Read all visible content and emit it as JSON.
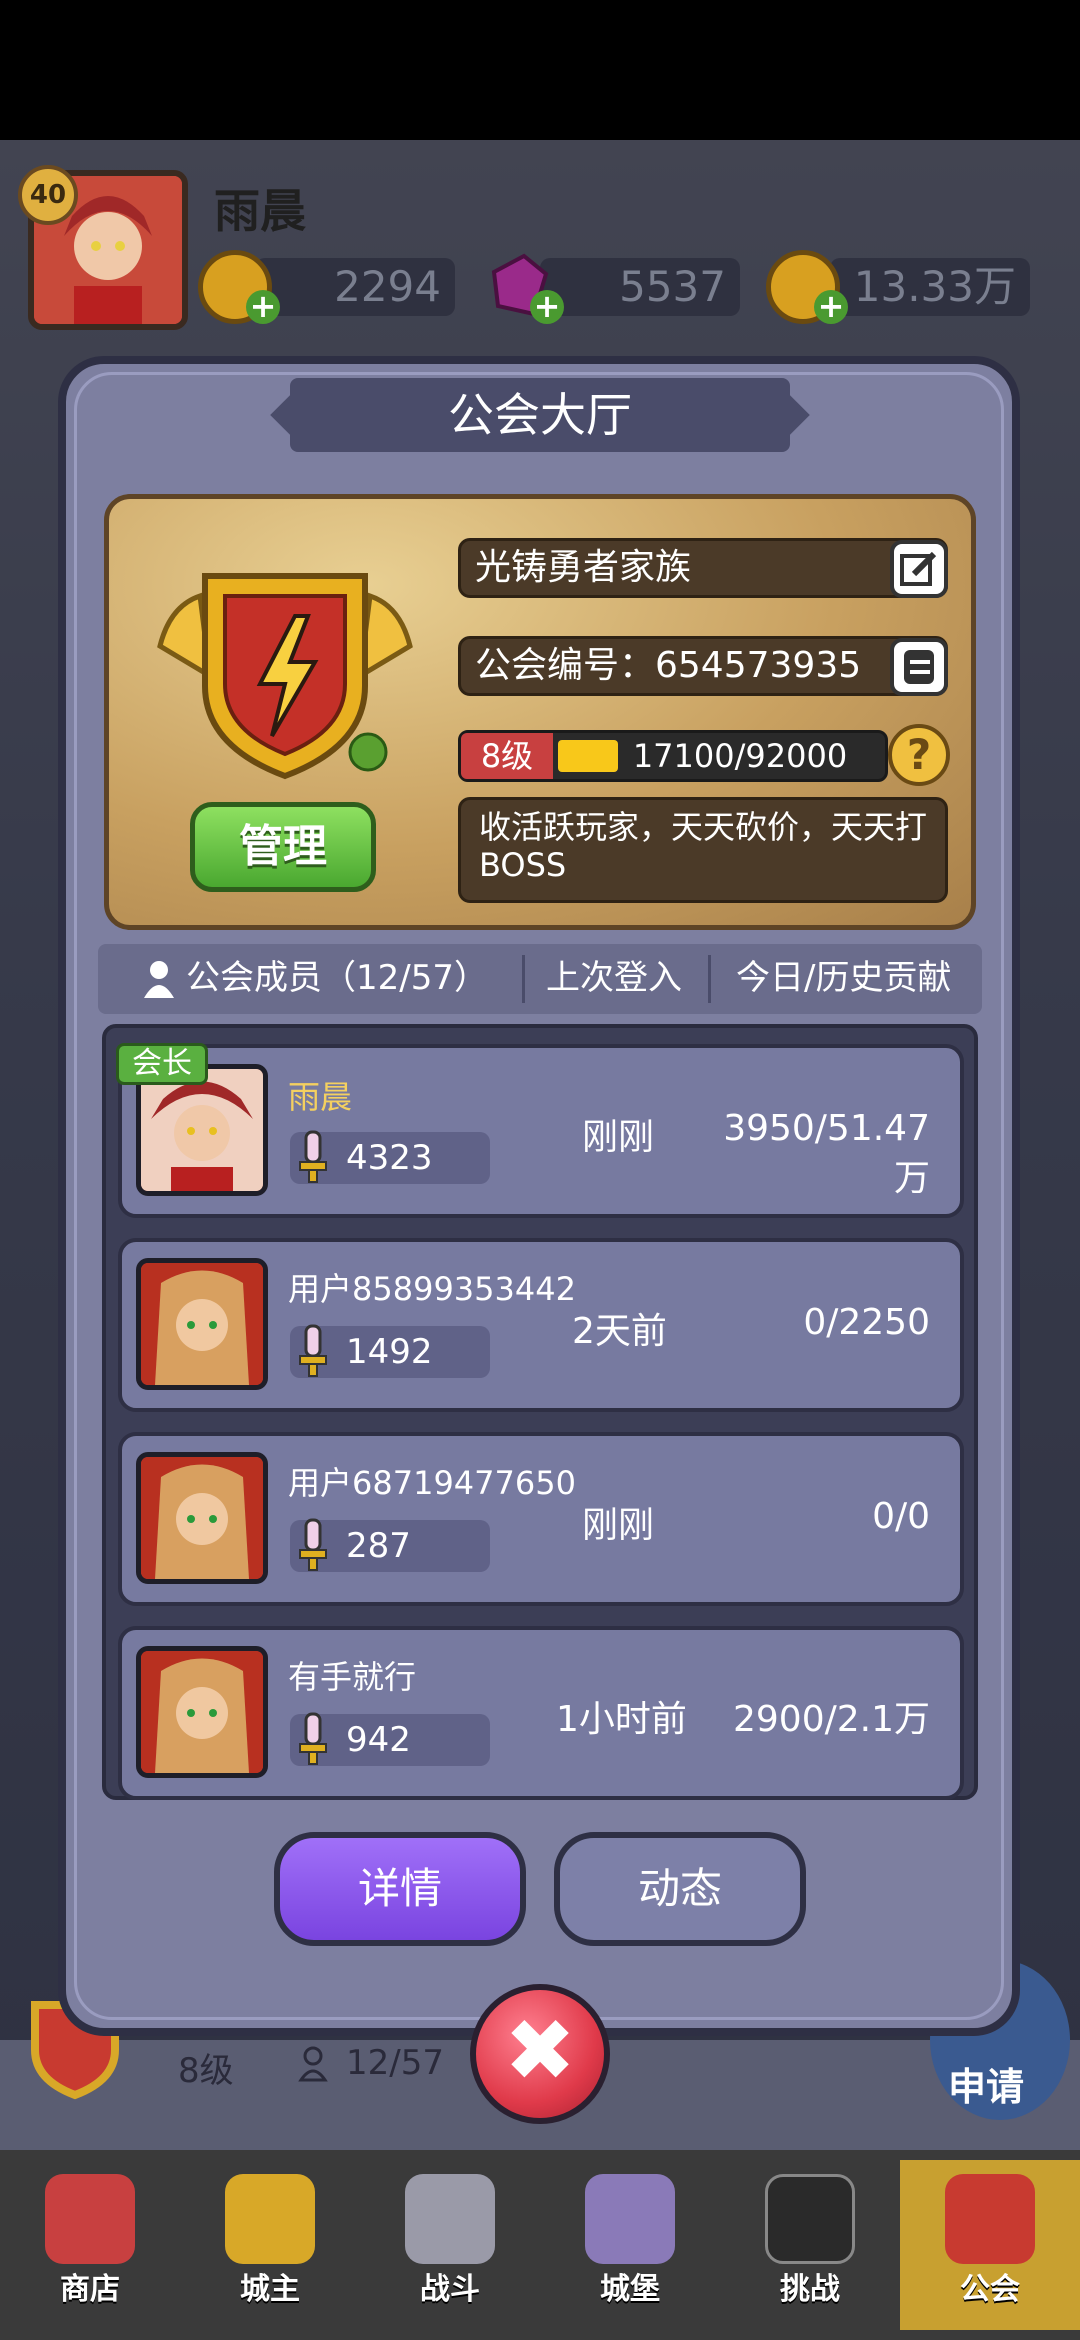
{
  "player": {
    "level": "40",
    "name": "雨晨"
  },
  "resources": [
    {
      "icon": "gold-coin-icon",
      "value": "2294"
    },
    {
      "icon": "purple-gem-icon",
      "value": "5537"
    },
    {
      "icon": "star-coin-icon",
      "value": "13.33万"
    }
  ],
  "panel": {
    "title": "公会大厅"
  },
  "guild": {
    "name": "光铸勇者家族",
    "id_label": "公会编号：654573935",
    "level": "8级",
    "xp": "17100/92000",
    "xp_progress": 0.186,
    "help": "?",
    "manage_label": "管理",
    "slogan": "收活跃玩家，天天砍价，天天打BOSS"
  },
  "list_header": {
    "members": "公会成员（12/57）",
    "last_login": "上次登入",
    "contribution": "今日/历史贡献"
  },
  "members": [
    {
      "name": "雨晨",
      "power": "4323",
      "last": "刚刚",
      "contrib": "3950/51.47万",
      "badge": "会长"
    },
    {
      "name": "用户85899353442",
      "power": "1492",
      "last": "2天前",
      "contrib": "0/2250"
    },
    {
      "name": "用户68719477650",
      "power": "287",
      "last": "刚刚",
      "contrib": "0/0"
    },
    {
      "name": "有手就行",
      "power": "942",
      "last": "1小时前",
      "contrib": "2900/2.1万"
    }
  ],
  "buttons": {
    "detail": "详情",
    "dynamic": "动态",
    "close": "✖"
  },
  "under_panel": {
    "level": "8级",
    "members": "12/57",
    "apply": "申请"
  },
  "nav": [
    {
      "label": "商店",
      "icon": "shop-icon"
    },
    {
      "label": "城主",
      "icon": "crown-icon"
    },
    {
      "label": "战斗",
      "icon": "crossed-swords-icon"
    },
    {
      "label": "城堡",
      "icon": "castle-icon"
    },
    {
      "label": "挑战",
      "icon": "demon-icon"
    },
    {
      "label": "公会",
      "icon": "guild-banner-icon"
    }
  ]
}
